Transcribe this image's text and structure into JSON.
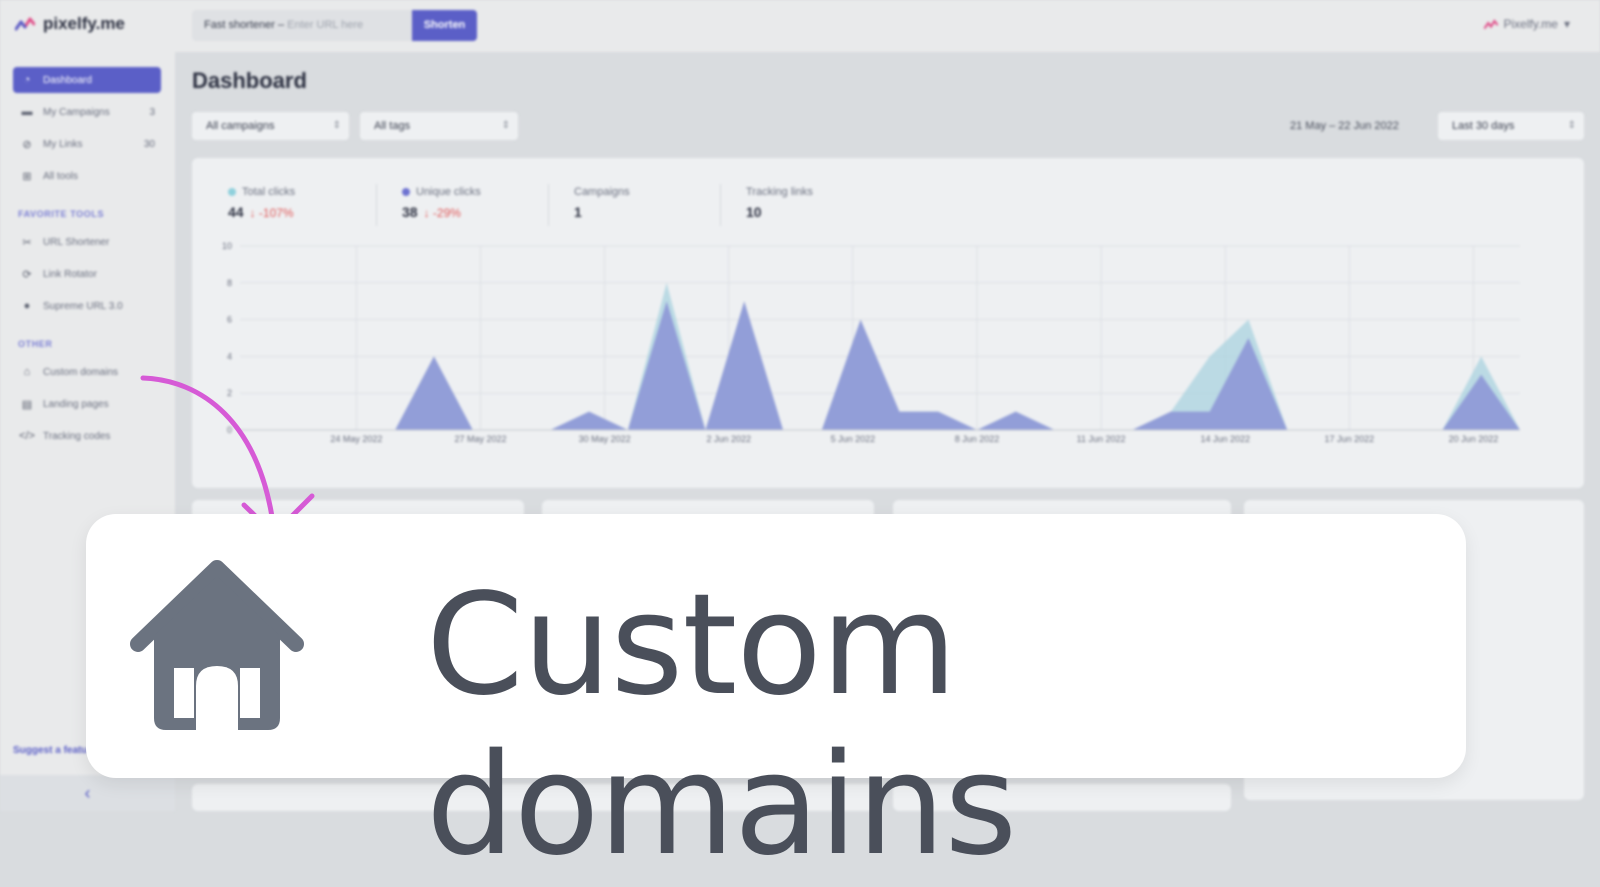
{
  "app": {
    "brand": "pixelfy.me",
    "shortener": {
      "prefix": "Fast shortener – ",
      "placeholder": "Enter URL here",
      "button": "Shorten"
    },
    "account": "Pixelfy.me"
  },
  "sidebar": {
    "items": [
      {
        "label": "Dashboard",
        "icon": "dashboard-icon",
        "count": ""
      },
      {
        "label": "My Campaigns",
        "icon": "folder-icon",
        "count": "3"
      },
      {
        "label": "My Links",
        "icon": "link-icon",
        "count": "30"
      },
      {
        "label": "All tools",
        "icon": "grid-icon",
        "count": ""
      }
    ],
    "favorite_title": "FAVORITE TOOLS",
    "favorites": [
      {
        "label": "URL Shortener",
        "icon": "scissors-icon"
      },
      {
        "label": "Link Rotator",
        "icon": "rotate-icon"
      },
      {
        "label": "Supreme URL 3.0",
        "icon": "supreme-icon"
      }
    ],
    "other_title": "OTHER",
    "other": [
      {
        "label": "Custom domains",
        "icon": "home-icon"
      },
      {
        "label": "Landing pages",
        "icon": "landing-icon"
      },
      {
        "label": "Tracking codes",
        "icon": "code-icon"
      }
    ],
    "suggest": "Suggest a featu"
  },
  "dashboard": {
    "title": "Dashboard",
    "filters": {
      "campaigns": "All campaigns",
      "tags": "All tags",
      "period": "Last 30 days"
    },
    "date_range": "21 May – 22 Jun 2022",
    "stats": [
      {
        "label": "Total clicks",
        "value": "44",
        "delta": "↓ -107%",
        "color": "#8fd0dc"
      },
      {
        "label": "Unique clicks",
        "value": "38",
        "delta": "↓ -29%",
        "color": "#6d72d1"
      },
      {
        "label": "Campaigns",
        "value": "1",
        "delta": "",
        "color": ""
      },
      {
        "label": "Tracking links",
        "value": "10",
        "delta": "",
        "color": ""
      }
    ]
  },
  "chart_data": {
    "type": "area",
    "x_ticks": [
      "24 May 2022",
      "27 May 2022",
      "30 May 2022",
      "2 Jun 2022",
      "5 Jun 2022",
      "8 Jun 2022",
      "11 Jun 2022",
      "14 Jun 2022",
      "17 Jun 2022",
      "20 Jun 2022"
    ],
    "y_ticks": [
      0,
      2,
      4,
      6,
      8,
      10
    ],
    "ylim": [
      0,
      10
    ],
    "series": [
      {
        "name": "Total clicks",
        "color": "#a9d3df",
        "values": [
          0,
          0,
          0,
          0,
          0,
          4,
          0,
          0,
          0,
          1,
          0,
          8,
          0,
          7,
          0,
          0,
          6,
          1,
          1,
          0,
          1,
          0,
          0,
          0,
          1,
          4,
          6,
          0,
          0,
          0,
          0,
          0,
          4,
          0
        ]
      },
      {
        "name": "Unique clicks",
        "color": "#8e97d6",
        "values": [
          0,
          0,
          0,
          0,
          0,
          4,
          0,
          0,
          0,
          1,
          0,
          7,
          0,
          7,
          0,
          0,
          6,
          1,
          1,
          0,
          1,
          0,
          0,
          0,
          1,
          1,
          5,
          0,
          0,
          0,
          0,
          0,
          3,
          0
        ]
      }
    ]
  },
  "callout": {
    "label": "Custom domains",
    "icon": "home-icon"
  }
}
